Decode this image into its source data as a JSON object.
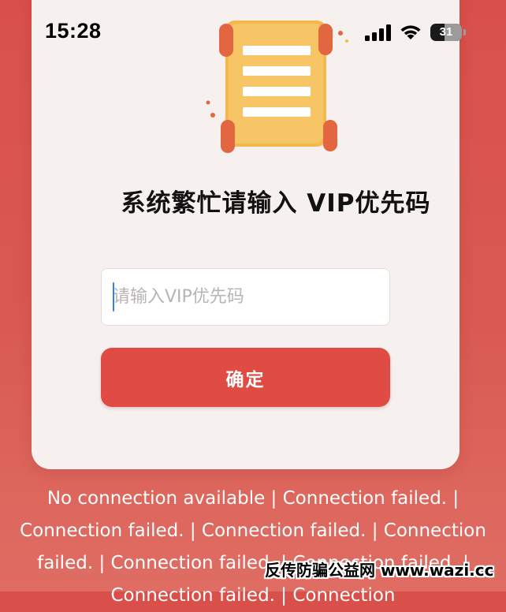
{
  "status_bar": {
    "time": "15:28",
    "battery_level": "31",
    "icons": [
      "signal-icon",
      "wifi-icon",
      "battery-icon"
    ]
  },
  "dialog": {
    "illustration": "scroll-icon",
    "title": "系统繁忙请输入 VIP优先码",
    "input": {
      "value": "",
      "placeholder": "请输入VIP优先码"
    },
    "confirm_label": "确定"
  },
  "error_log": "No connection available | Connection failed. | Connection failed. | Connection failed. | Connection failed. | Connection failed. | Connection failed. | Connection failed. | Connection",
  "watermark": "反传防骗公益网 www.wazi.cc",
  "colors": {
    "background": "#d9504a",
    "card": "#f6f1ef",
    "button": "#e04b44",
    "scroll_paper": "#f4b94a",
    "scroll_roller": "#e2663f"
  }
}
